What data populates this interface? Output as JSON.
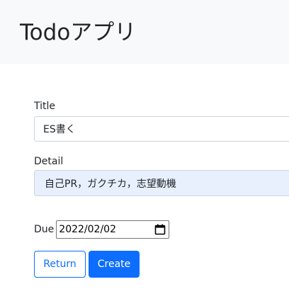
{
  "header": {
    "app_title": "Todoアプリ"
  },
  "form": {
    "title_label": "Title",
    "title_value": "ES書く",
    "detail_label": "Detail",
    "detail_value": "自己PR，ガクチカ，志望動機",
    "due_label": "Due",
    "due_value": "2022/02/02",
    "due_icon": "calendar-icon"
  },
  "buttons": {
    "return_label": "Return",
    "create_label": "Create"
  },
  "colors": {
    "primary": "#0d6efd",
    "header_bg": "#f8f9fa",
    "autofill_bg": "#e8f0fe"
  }
}
